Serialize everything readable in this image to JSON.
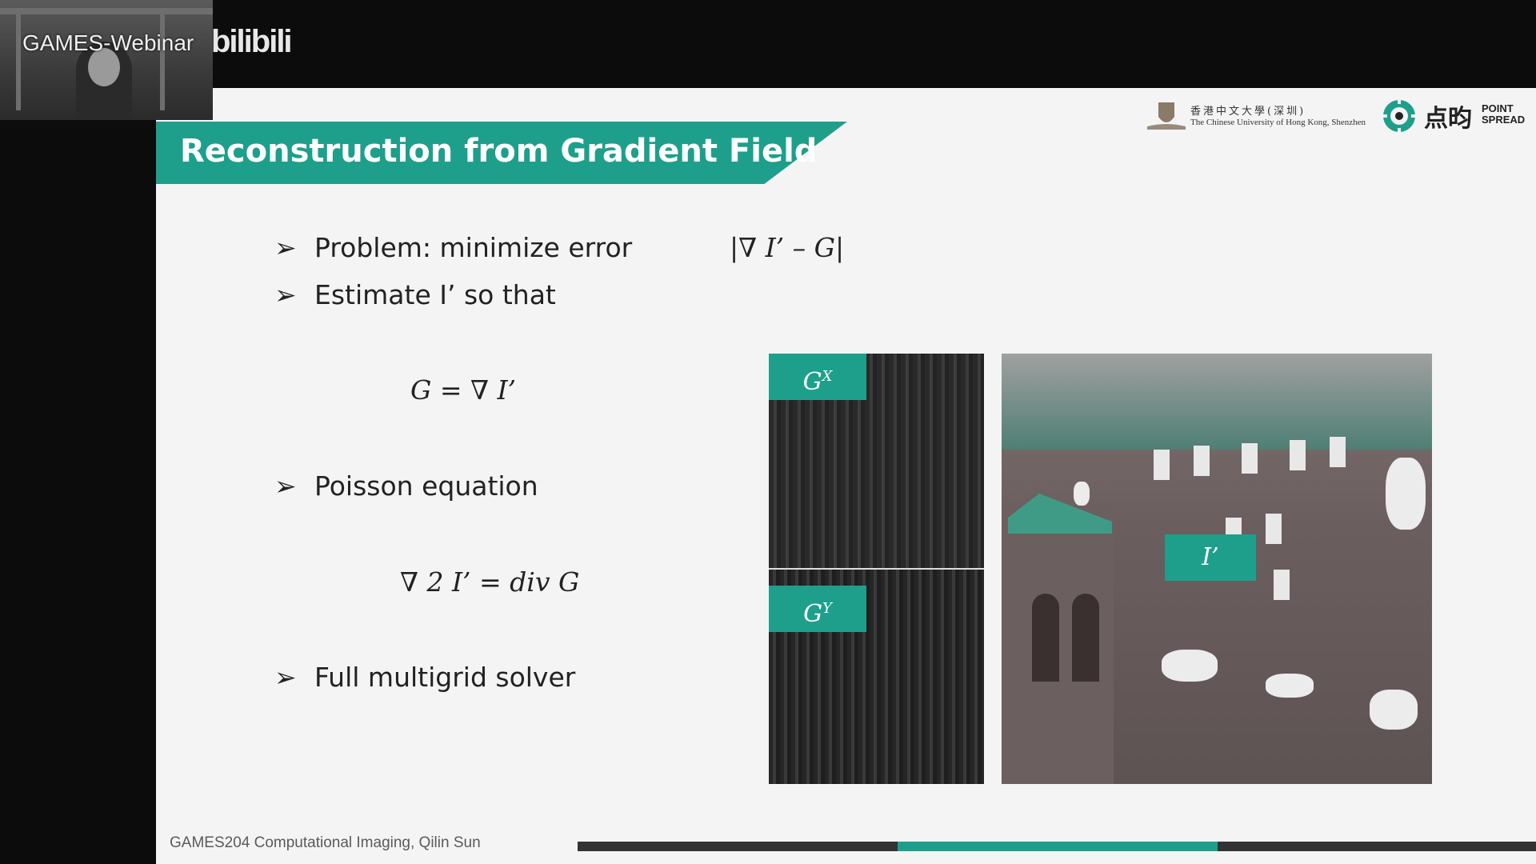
{
  "overlay": {
    "brand_text": "GAMES-Webinar",
    "platform_text": "bilibili"
  },
  "slide": {
    "title": "Reconstruction from Gradient Field",
    "logos": {
      "cuhk_cn": "香港中文大學(深圳)",
      "cuhk_en": "The Chinese University of Hong Kong, Shenzhen",
      "pointspread_cn": "点昀",
      "pointspread_en_1": "POINT",
      "pointspread_en_2": "SPREAD"
    },
    "arrow_glyph": "➢",
    "bullets": [
      "Problem: minimize error",
      "Estimate I’ so that",
      "Poisson equation",
      "Full multigrid solver"
    ],
    "equations": {
      "error": "|∇ I’ – G|",
      "gradient": "G = ∇ I’",
      "poisson": "∇ 2 I’ = div G"
    },
    "image_tags": {
      "gx": "G",
      "gx_sup": "X",
      "gy": "G",
      "gy_sup": "Y",
      "iprime": "I’"
    },
    "footer": "GAMES204 Computational Imaging, Qilin Sun"
  },
  "colors": {
    "accent": "#1e9f8c",
    "background": "#f4f4f4",
    "dark": "#0c0c0c"
  }
}
